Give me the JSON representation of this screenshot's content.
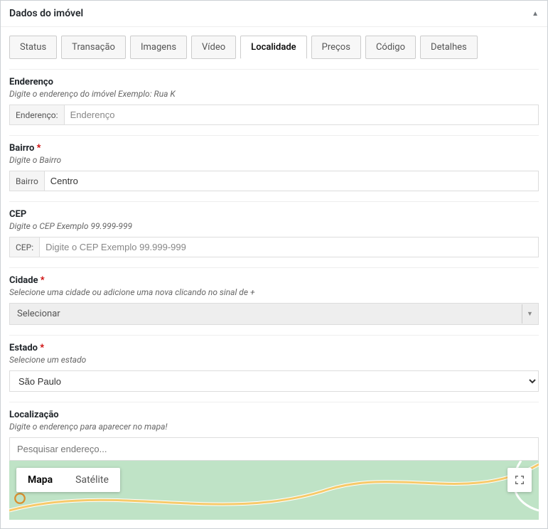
{
  "panel": {
    "title": "Dados do imóvel"
  },
  "tabs": [
    {
      "label": "Status",
      "active": false
    },
    {
      "label": "Transação",
      "active": false
    },
    {
      "label": "Imagens",
      "active": false
    },
    {
      "label": "Vídeo",
      "active": false
    },
    {
      "label": "Localidade",
      "active": true
    },
    {
      "label": "Preços",
      "active": false
    },
    {
      "label": "Código",
      "active": false
    },
    {
      "label": "Detalhes",
      "active": false
    }
  ],
  "fields": {
    "endereco": {
      "label": "Enderenço",
      "hint": "Digite o enderenço do imóvel Exemplo: Rua K",
      "prefix": "Enderenço:",
      "placeholder": "Enderenço",
      "value": ""
    },
    "bairro": {
      "label": "Bairro",
      "required": "*",
      "hint": "Digite o Bairro",
      "prefix": "Bairro",
      "value": "Centro"
    },
    "cep": {
      "label": "CEP",
      "hint": "Digite o CEP Exemplo 99.999-999",
      "prefix": "CEP:",
      "placeholder": "Digite o CEP Exemplo 99.999-999",
      "value": ""
    },
    "cidade": {
      "label": "Cidade",
      "required": "*",
      "hint": "Selecione uma cidade ou adicione uma nova clicando no sinal de +",
      "placeholder": "Selecionar"
    },
    "estado": {
      "label": "Estado",
      "required": "*",
      "hint": "Selecione um estado",
      "value": "São Paulo"
    },
    "localizacao": {
      "label": "Localização",
      "hint": "Digite o enderenço para aparecer no mapa!",
      "placeholder": "Pesquisar endereço..."
    }
  },
  "map": {
    "type_map": "Mapa",
    "type_sat": "Satélite"
  }
}
